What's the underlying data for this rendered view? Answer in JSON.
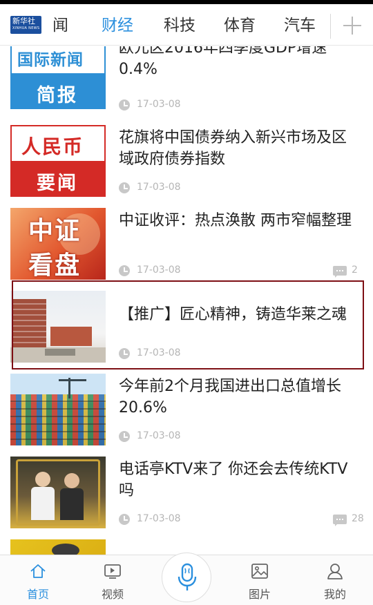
{
  "app": {
    "logo_text": "新华社",
    "logo_subtext": "XINHUA NEWS"
  },
  "tabs": [
    {
      "label": "闻",
      "active": false
    },
    {
      "label": "财经",
      "active": true
    },
    {
      "label": "科技",
      "active": false
    },
    {
      "label": "体育",
      "active": false
    },
    {
      "label": "汽车",
      "active": false
    }
  ],
  "add_tab_icon": "plus-icon",
  "feed": {
    "items": [
      {
        "title": "欧元区2016年四季度GDP增速0.4%",
        "date": "17-03-08",
        "comments": "",
        "thumb_top": "国际新闻",
        "thumb_bottom": "简报"
      },
      {
        "title": "花旗将中国债券纳入新兴市场及区域政府债券指数",
        "date": "17-03-08",
        "comments": "",
        "thumb_top": "人民币",
        "thumb_bottom": "要闻"
      },
      {
        "title": "中证收评：热点涣散 两市窄幅整理",
        "date": "17-03-08",
        "comments": "2",
        "thumb_top": "中证",
        "thumb_bottom": "看盘"
      },
      {
        "title": "【推广】匠心精神，铸造华莱之魂",
        "date": "17-03-08",
        "comments": ""
      },
      {
        "title": "今年前2个月我国进出口总值增长20.6%",
        "date": "17-03-08",
        "comments": ""
      },
      {
        "title": "电话亭KTV来了 你还会去传统KTV吗",
        "date": "17-03-08",
        "comments": "28"
      }
    ]
  },
  "bottom_nav": [
    {
      "label": "首页",
      "icon": "home-icon",
      "active": true
    },
    {
      "label": "视频",
      "icon": "video-icon",
      "active": false
    },
    {
      "label": "",
      "icon": "microphone-icon",
      "active": false
    },
    {
      "label": "图片",
      "icon": "image-icon",
      "active": false
    },
    {
      "label": "我的",
      "icon": "user-icon",
      "active": false
    }
  ],
  "colors": {
    "accent": "#2a8fde",
    "highlight_border": "#7d0e13",
    "meta_gray": "#b5b5b5"
  }
}
